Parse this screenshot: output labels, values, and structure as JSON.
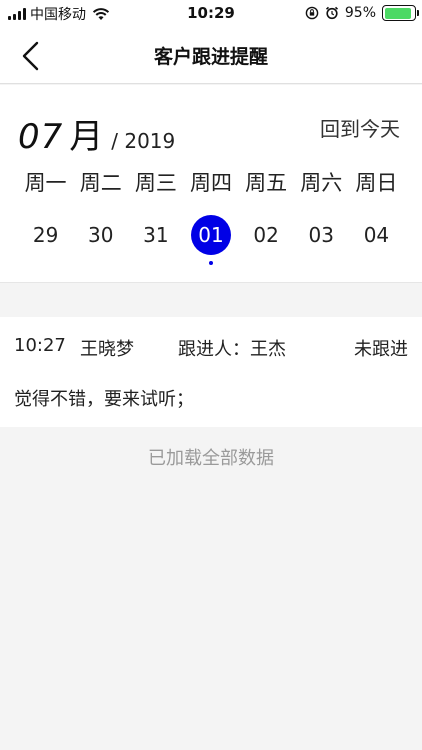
{
  "status_bar": {
    "carrier": "中国移动",
    "time": "10:29",
    "battery_percent": "95%",
    "battery_color": "#4cd964",
    "icons": [
      "signal-icon",
      "wifi-icon",
      "rotation-lock-icon",
      "alarm-icon",
      "battery-icon"
    ]
  },
  "nav": {
    "title": "客户跟进提醒",
    "back_icon": "chevron-left-icon"
  },
  "calendar": {
    "month": "07",
    "month_char": "月",
    "year": "/ 2019",
    "today_label": "回到今天",
    "weekdays": [
      "周一",
      "周二",
      "周三",
      "周四",
      "周五",
      "周六",
      "周日"
    ],
    "dates": [
      "29",
      "30",
      "31",
      "01",
      "02",
      "03",
      "04"
    ],
    "selected_index": 3,
    "accent_color": "#0000e6"
  },
  "record": {
    "time": "10:27",
    "name": "王晓梦",
    "follower": "跟进人：王杰",
    "status": "未跟进",
    "note": "觉得不错，要来试听；"
  },
  "footer": {
    "load_all": "已加载全部数据"
  }
}
